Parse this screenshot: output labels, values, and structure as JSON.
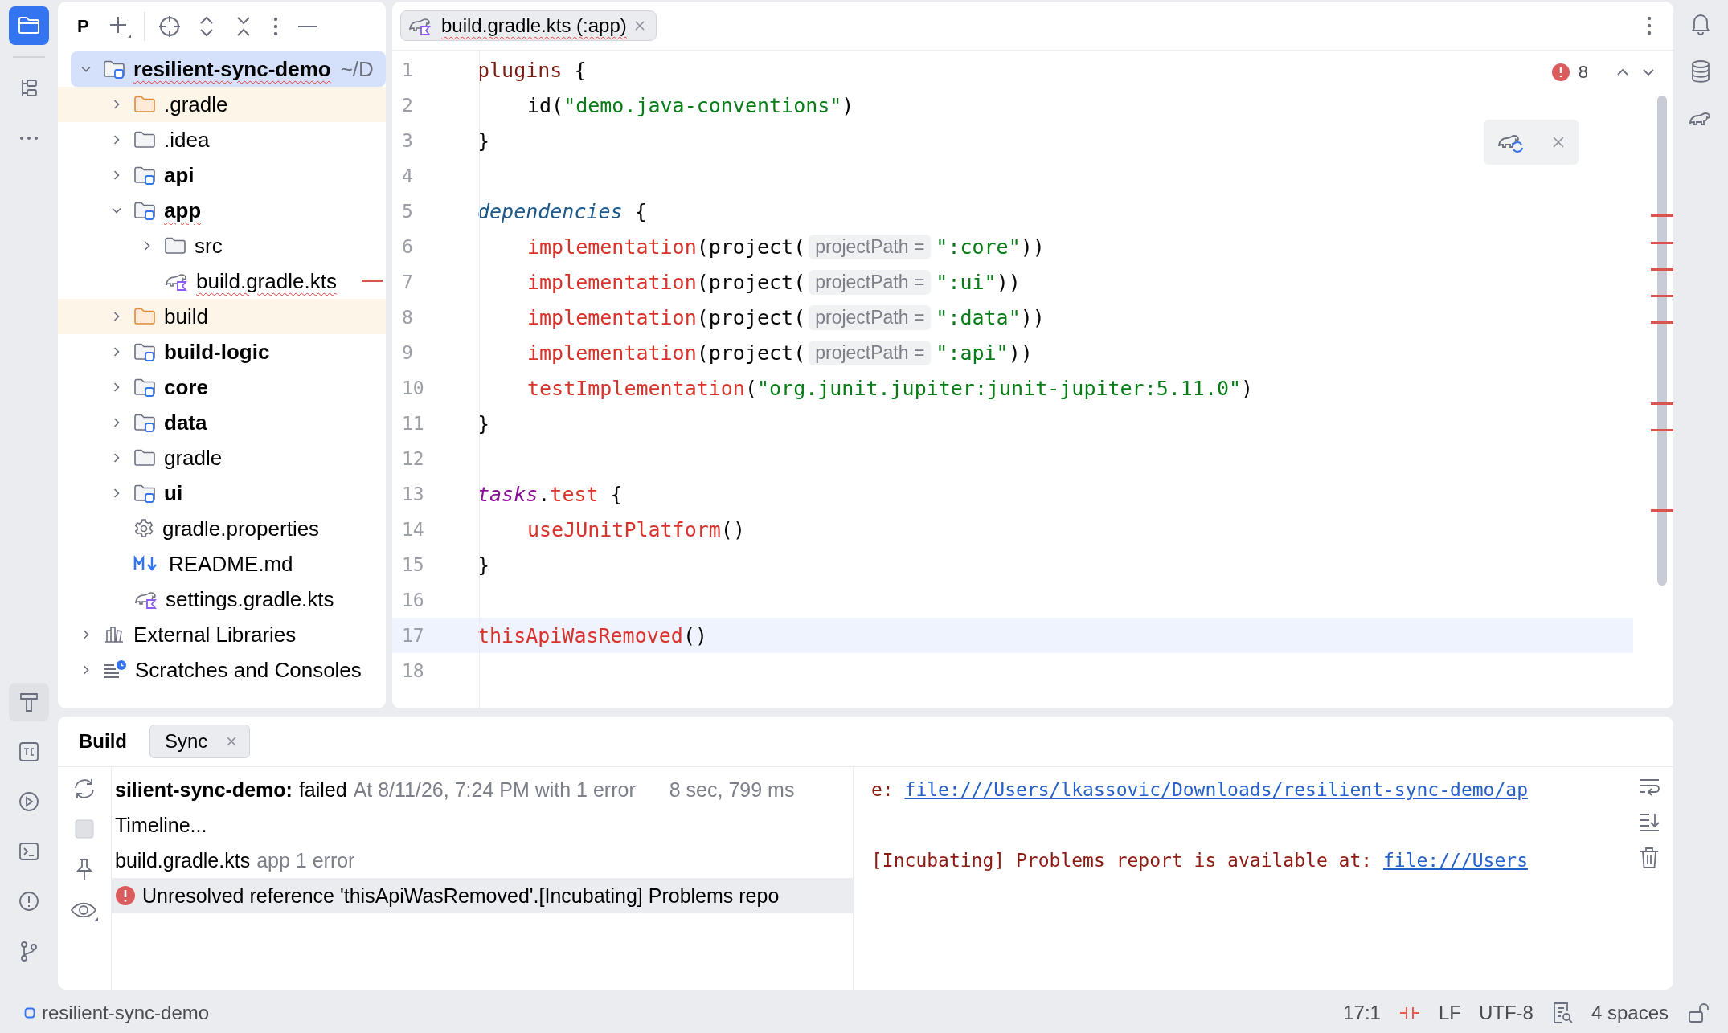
{
  "project": {
    "title": "P",
    "tree": [
      {
        "name": "resilient-sync-demo",
        "path": "~/D",
        "kind": "module",
        "expanded": true,
        "selected": true,
        "error": true,
        "children": [
          {
            "name": ".gradle",
            "kind": "excluded",
            "expanded": false,
            "selected": false,
            "error": false
          },
          {
            "name": ".idea",
            "kind": "folder",
            "expanded": false,
            "selected": false,
            "error": false
          },
          {
            "name": "api",
            "kind": "module",
            "expanded": false,
            "selected": false,
            "error": false
          },
          {
            "name": "app",
            "kind": "module",
            "expanded": true,
            "selected": false,
            "error": true,
            "children": [
              {
                "name": "src",
                "kind": "folder",
                "expanded": false,
                "selected": false,
                "error": false
              },
              {
                "name": "build.gradle.kts",
                "kind": "gradle-file",
                "selected": false,
                "error": true
              }
            ]
          },
          {
            "name": "build",
            "kind": "excluded",
            "expanded": false,
            "selected": false,
            "error": false
          },
          {
            "name": "build-logic",
            "kind": "module",
            "expanded": false,
            "selected": false,
            "error": false
          },
          {
            "name": "core",
            "kind": "module",
            "expanded": false,
            "selected": false,
            "error": false
          },
          {
            "name": "data",
            "kind": "module",
            "expanded": false,
            "selected": false,
            "error": false
          },
          {
            "name": "gradle",
            "kind": "folder",
            "expanded": false,
            "selected": false,
            "error": false
          },
          {
            "name": "ui",
            "kind": "module",
            "expanded": false,
            "selected": false,
            "error": false
          },
          {
            "name": "gradle.properties",
            "kind": "properties",
            "selected": false,
            "error": false
          },
          {
            "name": "README.md",
            "kind": "markdown",
            "selected": false,
            "error": false
          },
          {
            "name": "settings.gradle.kts",
            "kind": "gradle-file",
            "selected": false,
            "error": false
          }
        ]
      },
      {
        "name": "External Libraries",
        "kind": "libraries",
        "expanded": false,
        "selected": false,
        "error": false
      },
      {
        "name": "Scratches and Consoles",
        "kind": "scratches",
        "expanded": false,
        "selected": false,
        "error": false
      }
    ]
  },
  "editor": {
    "tab": {
      "label": "build.gradle.kts (:app)",
      "error": true
    },
    "problems": "8",
    "lines": [
      {
        "number": "1",
        "indented": false,
        "current": false,
        "tokens": [
          {
            "kind": "keyword",
            "text": "plugins"
          },
          {
            "kind": "plain",
            "text": " {"
          }
        ]
      },
      {
        "number": "2",
        "indented": true,
        "current": false,
        "tokens": [
          {
            "kind": "plain",
            "text": "id("
          },
          {
            "kind": "string",
            "text": "\"demo.java-conventions\""
          },
          {
            "kind": "plain",
            "text": ")"
          }
        ]
      },
      {
        "number": "3",
        "indented": false,
        "current": false,
        "tokens": [
          {
            "kind": "plain",
            "text": "}"
          }
        ]
      },
      {
        "number": "4",
        "current": false
      },
      {
        "number": "5",
        "indented": false,
        "current": false,
        "tokens": [
          {
            "kind": "type",
            "text": "dependencies"
          },
          {
            "kind": "plain",
            "text": " {"
          }
        ]
      },
      {
        "number": "6",
        "indented": true,
        "current": false,
        "tokens": [
          {
            "kind": "unresolved",
            "text": "implementation"
          },
          {
            "kind": "plain",
            "text": "(project("
          },
          {
            "kind": "hint",
            "text": "projectPath ="
          },
          {
            "kind": "string",
            "text": "\":core\""
          },
          {
            "kind": "plain",
            "text": "))"
          }
        ]
      },
      {
        "number": "7",
        "indented": true,
        "current": false,
        "tokens": [
          {
            "kind": "unresolved",
            "text": "implementation"
          },
          {
            "kind": "plain",
            "text": "(project("
          },
          {
            "kind": "hint",
            "text": "projectPath ="
          },
          {
            "kind": "string",
            "text": "\":ui\""
          },
          {
            "kind": "plain",
            "text": "))"
          }
        ]
      },
      {
        "number": "8",
        "indented": true,
        "current": false,
        "tokens": [
          {
            "kind": "unresolved",
            "text": "implementation"
          },
          {
            "kind": "plain",
            "text": "(project("
          },
          {
            "kind": "hint",
            "text": "projectPath ="
          },
          {
            "kind": "string",
            "text": "\":data\""
          },
          {
            "kind": "plain",
            "text": "))"
          }
        ]
      },
      {
        "number": "9",
        "indented": true,
        "current": false,
        "tokens": [
          {
            "kind": "unresolved",
            "text": "implementation"
          },
          {
            "kind": "plain",
            "text": "(project("
          },
          {
            "kind": "hint",
            "text": "projectPath ="
          },
          {
            "kind": "string",
            "text": "\":api\""
          },
          {
            "kind": "plain",
            "text": "))"
          }
        ]
      },
      {
        "number": "10",
        "indented": true,
        "current": false,
        "tokens": [
          {
            "kind": "unresolved",
            "text": "testImplementation"
          },
          {
            "kind": "plain",
            "text": "("
          },
          {
            "kind": "string",
            "text": "\"org.junit.jupiter:junit-jupiter:5.11.0\""
          },
          {
            "kind": "plain",
            "text": ")"
          }
        ]
      },
      {
        "number": "11",
        "indented": false,
        "current": false,
        "tokens": [
          {
            "kind": "plain",
            "text": "}"
          }
        ]
      },
      {
        "number": "12",
        "current": false
      },
      {
        "number": "13",
        "indented": false,
        "current": false,
        "tokens": [
          {
            "kind": "extension",
            "text": "tasks"
          },
          {
            "kind": "plain",
            "text": "."
          },
          {
            "kind": "unresolved",
            "text": "test"
          },
          {
            "kind": "plain",
            "text": " {"
          }
        ]
      },
      {
        "number": "14",
        "indented": true,
        "current": false,
        "tokens": [
          {
            "kind": "unresolved",
            "text": "useJUnitPlatform"
          },
          {
            "kind": "plain",
            "text": "()"
          }
        ]
      },
      {
        "number": "15",
        "indented": false,
        "current": false,
        "tokens": [
          {
            "kind": "plain",
            "text": "}"
          }
        ]
      },
      {
        "number": "16",
        "current": false
      },
      {
        "number": "17",
        "indented": false,
        "current": true,
        "tokens": [
          {
            "kind": "unresolved",
            "text": "thisApiWasRemoved"
          },
          {
            "kind": "plain",
            "text": "()"
          }
        ]
      },
      {
        "number": "18",
        "current": false
      }
    ]
  },
  "build": {
    "title": "Build",
    "tabs": [
      {
        "label": "Sync",
        "selected": true
      }
    ],
    "rows": [
      {
        "kind": "summary",
        "name": "silient-sync-demo:",
        "status": "failed",
        "detail": "At 8/11/26, 7:24 PM with 1 error",
        "duration": "8 sec, 799 ms",
        "selected": false
      },
      {
        "kind": "item",
        "name": "Timeline...",
        "selected": false
      },
      {
        "kind": "file",
        "name": "build.gradle.kts",
        "detail": "app 1 error",
        "selected": false
      },
      {
        "kind": "error",
        "name": "Unresolved reference 'thisApiWasRemoved'.[Incubating] Problems repo",
        "selected": true
      }
    ],
    "console": [
      {
        "prefix": "e: ",
        "link": "file:///Users/lkassovic/Downloads/resilient-sync-demo/ap"
      },
      {
        "prefix": "[Incubating] Problems report is available at: ",
        "link": "file:///Users"
      }
    ]
  },
  "status_bar": {
    "project": "resilient-sync-demo",
    "position": "17:1",
    "line_separator": "LF",
    "encoding": "UTF-8",
    "indent": "4 spaces"
  }
}
